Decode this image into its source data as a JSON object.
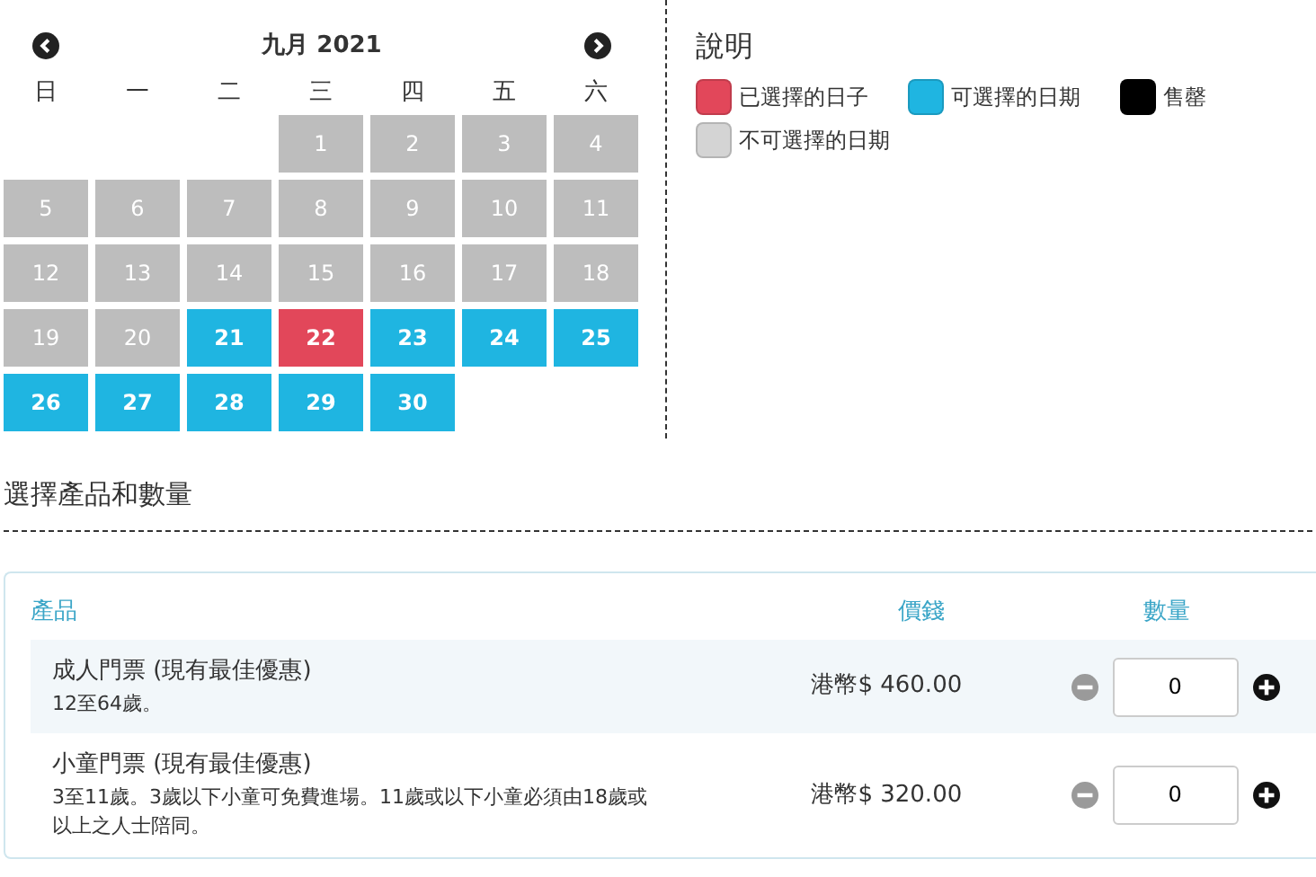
{
  "calendar": {
    "month_title": "九月 2021",
    "weekdays": [
      "日",
      "一",
      "二",
      "三",
      "四",
      "五",
      "六"
    ],
    "weeks": [
      [
        {
          "kind": "empty"
        },
        {
          "kind": "empty"
        },
        {
          "kind": "empty"
        },
        {
          "day": "1",
          "kind": "unavailable"
        },
        {
          "day": "2",
          "kind": "unavailable"
        },
        {
          "day": "3",
          "kind": "unavailable"
        },
        {
          "day": "4",
          "kind": "unavailable"
        }
      ],
      [
        {
          "day": "5",
          "kind": "unavailable"
        },
        {
          "day": "6",
          "kind": "unavailable"
        },
        {
          "day": "7",
          "kind": "unavailable"
        },
        {
          "day": "8",
          "kind": "unavailable"
        },
        {
          "day": "9",
          "kind": "unavailable"
        },
        {
          "day": "10",
          "kind": "unavailable"
        },
        {
          "day": "11",
          "kind": "unavailable"
        }
      ],
      [
        {
          "day": "12",
          "kind": "unavailable"
        },
        {
          "day": "13",
          "kind": "unavailable"
        },
        {
          "day": "14",
          "kind": "unavailable"
        },
        {
          "day": "15",
          "kind": "unavailable"
        },
        {
          "day": "16",
          "kind": "unavailable"
        },
        {
          "day": "17",
          "kind": "unavailable"
        },
        {
          "day": "18",
          "kind": "unavailable"
        }
      ],
      [
        {
          "day": "19",
          "kind": "unavailable"
        },
        {
          "day": "20",
          "kind": "unavailable"
        },
        {
          "day": "21",
          "kind": "available"
        },
        {
          "day": "22",
          "kind": "selected"
        },
        {
          "day": "23",
          "kind": "available"
        },
        {
          "day": "24",
          "kind": "available"
        },
        {
          "day": "25",
          "kind": "available"
        }
      ],
      [
        {
          "day": "26",
          "kind": "available"
        },
        {
          "day": "27",
          "kind": "available"
        },
        {
          "day": "28",
          "kind": "available"
        },
        {
          "day": "29",
          "kind": "available"
        },
        {
          "day": "30",
          "kind": "available"
        },
        {
          "kind": "empty"
        },
        {
          "kind": "empty"
        }
      ]
    ]
  },
  "legend": {
    "title": "說明",
    "items": [
      {
        "label": "已選擇的日子",
        "color": "#e2475a"
      },
      {
        "label": "可選擇的日期",
        "color": "#1fb5e1"
      },
      {
        "label": "售罄",
        "color": "#000000"
      },
      {
        "label": "不可選擇的日期",
        "color": "#d4d4d4"
      }
    ]
  },
  "products_section": {
    "title": "選擇產品和數量",
    "columns": [
      "產品",
      "價錢",
      "數量"
    ],
    "rows": [
      {
        "name": "成人門票 (現有最佳優惠)",
        "note": "12至64歲。",
        "price": "港幣$ 460.00",
        "quantity": "0",
        "decrease_disabled": true
      },
      {
        "name": "小童門票 (現有最佳優惠)",
        "note": "3至11歲。3歲以下小童可免費進場。11歲或以下小童必須由18歲或以上之人士陪同。",
        "price": "港幣$ 320.00",
        "quantity": "0",
        "decrease_disabled": true
      }
    ]
  }
}
